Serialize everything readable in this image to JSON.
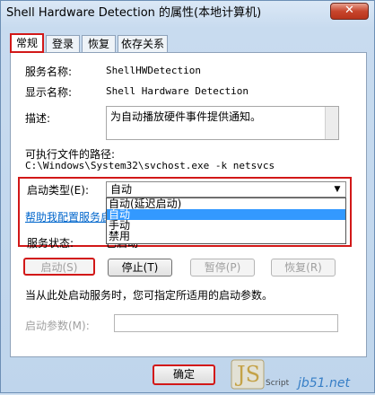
{
  "window": {
    "title": "Shell Hardware Detection 的属性(本地计算机)",
    "close_glyph": "✕"
  },
  "tabs": [
    {
      "label": "常规",
      "active": true
    },
    {
      "label": "登录",
      "active": false
    },
    {
      "label": "恢复",
      "active": false
    },
    {
      "label": "依存关系",
      "active": false
    }
  ],
  "general": {
    "service_name_label": "服务名称:",
    "service_name_value": "ShellHWDetection",
    "display_name_label": "显示名称:",
    "display_name_value": "Shell Hardware Detection",
    "description_label": "描述:",
    "description_value": "为自动播放硬件事件提供通知。",
    "exe_path_label": "可执行文件的路径:",
    "exe_path_value": "C:\\Windows\\System32\\svchost.exe -k netsvcs",
    "startup_type_label": "启动类型(E):",
    "startup_type_value": "自动",
    "startup_options": [
      "自动(延迟启动)",
      "自动",
      "手动",
      "禁用"
    ],
    "help_link": "帮助我配置服务启动",
    "service_status_label": "服务状态:",
    "service_status_value": "已启动",
    "buttons": {
      "start": "启动(S)",
      "stop": "停止(T)",
      "pause": "暂停(P)",
      "resume": "恢复(R)"
    },
    "hint_text": "当从此处启动服务时，您可指定所适用的启动参数。",
    "start_params_label": "启动参数(M):",
    "start_params_value": ""
  },
  "footer": {
    "ok": "确定"
  },
  "watermark": {
    "text": "jb51.net",
    "label": "Script"
  },
  "colors": {
    "highlight": "#d21818",
    "selection": "#3399ff",
    "link": "#0066cc"
  }
}
